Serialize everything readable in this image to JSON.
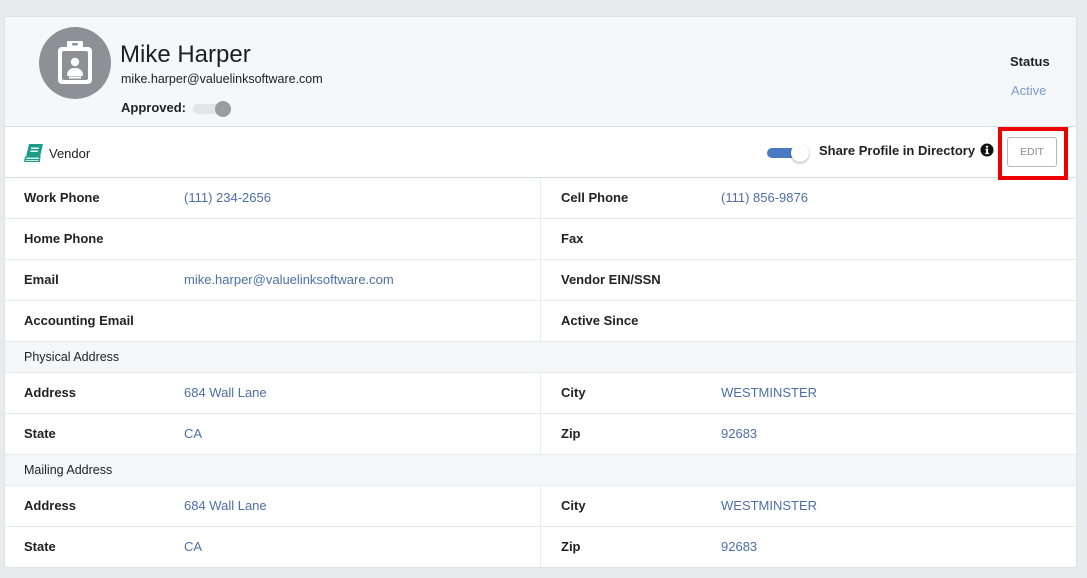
{
  "profile": {
    "name": "Mike Harper",
    "email": "mike.harper@valuelinksoftware.com",
    "approved_label": "Approved:",
    "approved": false,
    "status_label": "Status",
    "status_value": "Active"
  },
  "vendor_bar": {
    "type_label": "Vendor",
    "share_label": "Share Profile in Directory",
    "share_enabled": true,
    "edit_label": "EDIT"
  },
  "contact": {
    "work_phone_label": "Work Phone",
    "work_phone": "(111) 234-2656",
    "cell_phone_label": "Cell Phone",
    "cell_phone": "(111) 856-9876",
    "home_phone_label": "Home Phone",
    "home_phone": "",
    "fax_label": "Fax",
    "fax": "",
    "email_label": "Email",
    "email": "mike.harper@valuelinksoftware.com",
    "ein_label": "Vendor EIN/SSN",
    "ein": "",
    "accounting_email_label": "Accounting Email",
    "accounting_email": "",
    "active_since_label": "Active Since",
    "active_since": ""
  },
  "physical_address": {
    "section_label": "Physical Address",
    "address_label": "Address",
    "address": "684 Wall Lane",
    "city_label": "City",
    "city": "WESTMINSTER",
    "state_label": "State",
    "state": "CA",
    "zip_label": "Zip",
    "zip": "92683"
  },
  "mailing_address": {
    "section_label": "Mailing Address",
    "address_label": "Address",
    "address": "684 Wall Lane",
    "city_label": "City",
    "city": "WESTMINSTER",
    "state_label": "State",
    "state": "CA",
    "zip_label": "Zip",
    "zip": "92683"
  },
  "icons": {
    "avatar": "id-badge-icon",
    "vendor": "book-icon",
    "info": "info-circle-icon"
  },
  "colors": {
    "link": "#4d6fa8",
    "status": "#7f99cc",
    "toggle_on": "#4a7ac4",
    "vendor_icon": "#1a9c86",
    "highlight": "#ee0000"
  }
}
